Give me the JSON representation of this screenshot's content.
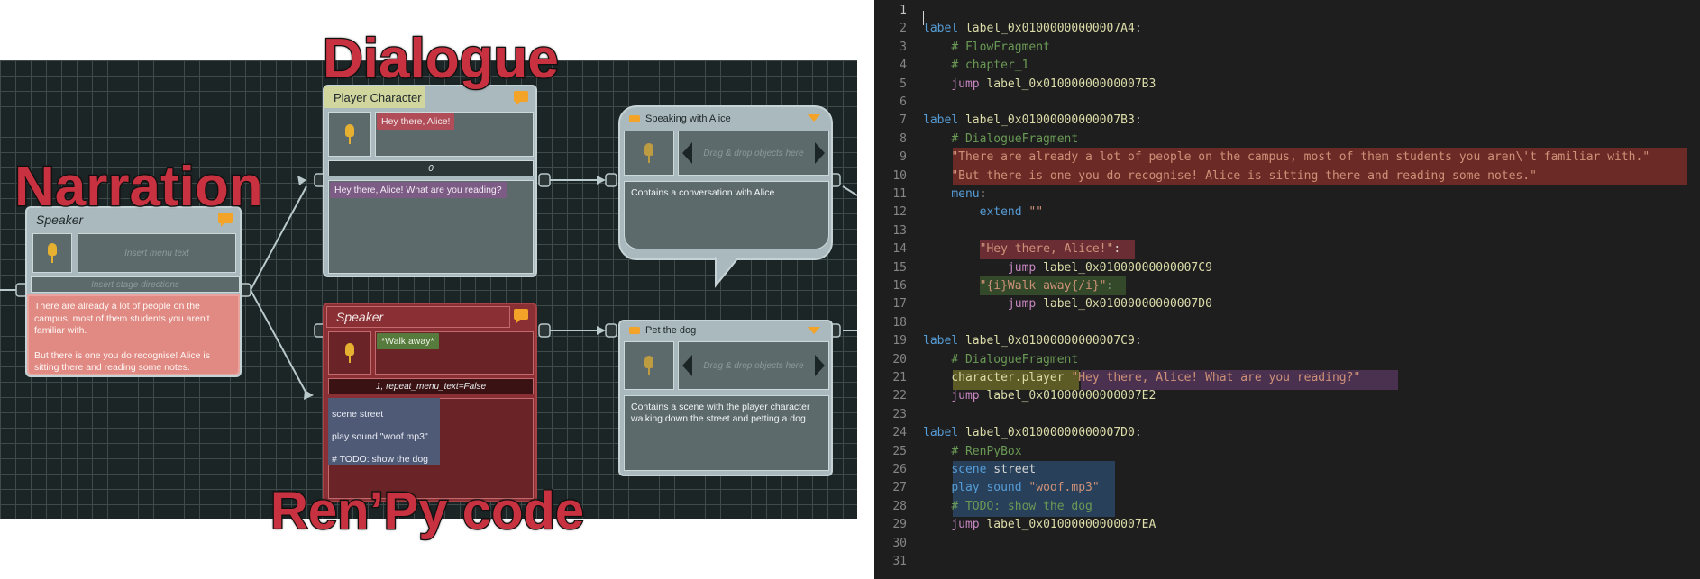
{
  "overlay": {
    "dialogue": "Dialogue",
    "narration": "Narration",
    "renpy": "Ren’Py code"
  },
  "narration_node": {
    "header": "Speaker",
    "menu_placeholder": "Insert menu text",
    "stage_placeholder": "Insert stage directions",
    "text": "There are already a lot of people on the campus, most of them students you aren't familiar with.\n\nBut there is one you do recognise! Alice is sitting there and reading some notes."
  },
  "dialogue_node": {
    "header": "Player Character",
    "menu_text": "Hey there, Alice!",
    "stage": "0",
    "text": "Hey there, Alice! What are you reading?"
  },
  "code_node": {
    "header": "Speaker",
    "menu_text": "*Walk away*",
    "stage": "1, repeat_menu_text=False",
    "lines": [
      "scene street",
      "play sound \"woof.mp3\"",
      "# TODO: show the dog"
    ]
  },
  "alice_node": {
    "header": "Speaking with Alice",
    "drop": "Drag & drop objects here",
    "text": "Contains a conversation with Alice"
  },
  "dog_node": {
    "header": "Pet the dog",
    "drop": "Drag & drop objects here",
    "text": "Contains a scene with the player character walking down the street and petting a dog"
  },
  "colors": {
    "canvas": "#1c2526",
    "narration_highlight": "#e08a83",
    "dialogue_highlight": "#6b2a26",
    "editor_bg": "#1e1e1e"
  },
  "editor": {
    "lines": [
      {
        "n": "1",
        "active": true,
        "parts": []
      },
      {
        "n": "2",
        "parts": [
          [
            "kw",
            "label "
          ],
          [
            "lbl",
            "label_0x01000000000007A4"
          ],
          [
            "plain",
            ":"
          ]
        ]
      },
      {
        "n": "3",
        "parts": [
          [
            "plain",
            "    "
          ],
          [
            "cmt",
            "# FlowFragment"
          ]
        ]
      },
      {
        "n": "4",
        "parts": [
          [
            "plain",
            "    "
          ],
          [
            "cmt",
            "# chapter_1"
          ]
        ]
      },
      {
        "n": "5",
        "parts": [
          [
            "plain",
            "    "
          ],
          [
            "kw2",
            "jump "
          ],
          [
            "lbl",
            "label_0x01000000000007B3"
          ]
        ]
      },
      {
        "n": "6",
        "parts": []
      },
      {
        "n": "7",
        "parts": [
          [
            "kw",
            "label "
          ],
          [
            "lbl",
            "label_0x01000000000007B3"
          ],
          [
            "plain",
            ":"
          ]
        ]
      },
      {
        "n": "8",
        "parts": [
          [
            "plain",
            "    "
          ],
          [
            "cmt",
            "# DialogueFragment"
          ]
        ]
      },
      {
        "n": "9",
        "parts": [
          [
            "plain",
            "    "
          ],
          [
            "str",
            "\"There are already a lot of people on the campus, most of them students you aren\\'t familiar with.\""
          ]
        ]
      },
      {
        "n": "10",
        "parts": [
          [
            "plain",
            "    "
          ],
          [
            "str",
            "\"But there is one you do recognise! Alice is sitting there and reading some notes.\""
          ]
        ]
      },
      {
        "n": "11",
        "parts": [
          [
            "plain",
            "    "
          ],
          [
            "kw",
            "menu"
          ],
          [
            "plain",
            ":"
          ]
        ]
      },
      {
        "n": "12",
        "parts": [
          [
            "plain",
            "        "
          ],
          [
            "kw",
            "extend "
          ],
          [
            "str",
            "\"\""
          ]
        ]
      },
      {
        "n": "13",
        "parts": []
      },
      {
        "n": "14",
        "parts": [
          [
            "plain",
            "        "
          ],
          [
            "str",
            "\"Hey there, Alice!\""
          ],
          [
            "plain",
            ":"
          ]
        ]
      },
      {
        "n": "15",
        "parts": [
          [
            "plain",
            "            "
          ],
          [
            "kw2",
            "jump "
          ],
          [
            "lbl",
            "label_0x01000000000007C9"
          ]
        ]
      },
      {
        "n": "16",
        "parts": [
          [
            "plain",
            "        "
          ],
          [
            "str",
            "\"{i}Walk away{/i}\""
          ],
          [
            "plain",
            ":"
          ]
        ]
      },
      {
        "n": "17",
        "parts": [
          [
            "plain",
            "            "
          ],
          [
            "kw2",
            "jump "
          ],
          [
            "lbl",
            "label_0x01000000000007D0"
          ]
        ]
      },
      {
        "n": "18",
        "parts": []
      },
      {
        "n": "19",
        "parts": [
          [
            "kw",
            "label "
          ],
          [
            "lbl",
            "label_0x01000000000007C9"
          ],
          [
            "plain",
            ":"
          ]
        ]
      },
      {
        "n": "20",
        "parts": [
          [
            "plain",
            "    "
          ],
          [
            "cmt",
            "# DialogueFragment"
          ]
        ]
      },
      {
        "n": "21",
        "parts": [
          [
            "plain",
            "    "
          ],
          [
            "lbl",
            "character.player"
          ],
          [
            "plain",
            " "
          ],
          [
            "str",
            "\"Hey there, Alice! What are you reading?\""
          ]
        ]
      },
      {
        "n": "22",
        "parts": [
          [
            "plain",
            "    "
          ],
          [
            "kw2",
            "jump "
          ],
          [
            "lbl",
            "label_0x01000000000007E2"
          ]
        ]
      },
      {
        "n": "23",
        "parts": []
      },
      {
        "n": "24",
        "parts": [
          [
            "kw",
            "label "
          ],
          [
            "lbl",
            "label_0x01000000000007D0"
          ],
          [
            "plain",
            ":"
          ]
        ]
      },
      {
        "n": "25",
        "parts": [
          [
            "plain",
            "    "
          ],
          [
            "cmt",
            "# RenPyBox"
          ]
        ]
      },
      {
        "n": "26",
        "parts": [
          [
            "plain",
            "    "
          ],
          [
            "kw",
            "scene "
          ],
          [
            "plain",
            "street"
          ]
        ]
      },
      {
        "n": "27",
        "parts": [
          [
            "plain",
            "    "
          ],
          [
            "kw",
            "play "
          ],
          [
            "kw",
            "sound "
          ],
          [
            "str",
            "\"woof.mp3\""
          ]
        ]
      },
      {
        "n": "28",
        "parts": [
          [
            "plain",
            "    "
          ],
          [
            "cmt",
            "# TODO: show the dog"
          ]
        ]
      },
      {
        "n": "29",
        "parts": [
          [
            "plain",
            "    "
          ],
          [
            "kw2",
            "jump "
          ],
          [
            "lbl",
            "label_0x01000000000007EA"
          ]
        ]
      },
      {
        "n": "30",
        "parts": []
      },
      {
        "n": "31",
        "parts": []
      }
    ]
  }
}
